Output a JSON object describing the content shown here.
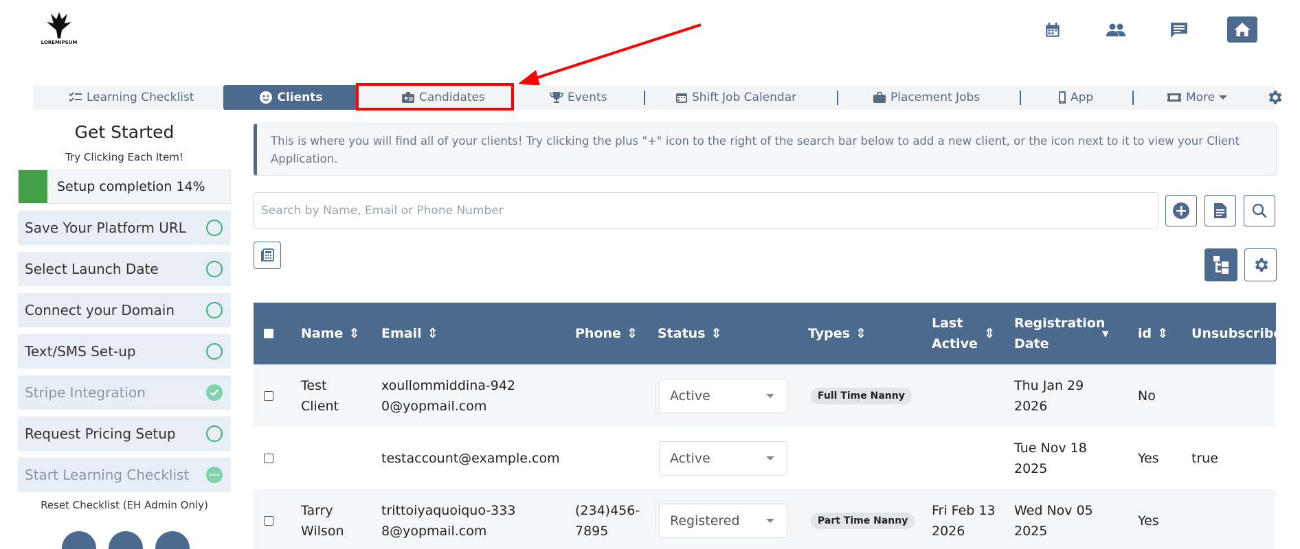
{
  "logo": {
    "text": "LOREMIPSUM"
  },
  "tabs": [
    {
      "label": "Learning Checklist"
    },
    {
      "label": "Clients"
    },
    {
      "label": "Candidates"
    },
    {
      "label": "Events"
    },
    {
      "label": "Shift Job Calendar"
    },
    {
      "label": "Placement Jobs"
    },
    {
      "label": "App"
    },
    {
      "label": "More"
    }
  ],
  "sidebar": {
    "title": "Get Started",
    "subtitle": "Try Clicking Each Item!",
    "progress": {
      "label": "Setup completion 14%",
      "percent": 14
    },
    "items": [
      {
        "label": "Save Your Platform URL",
        "status": "todo"
      },
      {
        "label": "Select Launch Date",
        "status": "todo"
      },
      {
        "label": "Connect your Domain",
        "status": "todo"
      },
      {
        "label": "Text/SMS Set-up",
        "status": "todo"
      },
      {
        "label": "Stripe Integration",
        "status": "done"
      },
      {
        "label": "Request Pricing Setup",
        "status": "todo"
      },
      {
        "label": "Start Learning Checklist",
        "status": "pending"
      }
    ],
    "reset_label": "Reset Checklist (EH Admin Only)"
  },
  "main": {
    "info_text": "This is where you will find all of your clients! Try clicking the plus \"+\" icon to the right of the search bar below to add a new client, or the icon next to it to view your Client Application.",
    "search_placeholder": "Search by Name, Email or Phone Number"
  },
  "table": {
    "columns": [
      "Name",
      "Email",
      "Phone",
      "Status",
      "Types",
      "Last Active",
      "Registration Date",
      "id",
      "Unsubscribed"
    ],
    "rows": [
      {
        "name": "Test Client",
        "email": "xoullommiddina-9420@yopmail.com",
        "phone": "",
        "status": "Active",
        "types": "Full Time Nanny",
        "last_active": "",
        "registration": "Thu Jan 29 2026",
        "id": "No",
        "unsubscribed": ""
      },
      {
        "name": "",
        "email": "testaccount@example.com",
        "phone": "",
        "status": "Active",
        "types": "",
        "last_active": "",
        "registration": "Tue Nov 18 2025",
        "id": "Yes",
        "unsubscribed": "true"
      },
      {
        "name": "Tarry Wilson",
        "email": "trittoiyaquoiquo-3338@yopmail.com",
        "phone": "(234)456-7895",
        "status": "Registered",
        "types": "Part Time Nanny",
        "last_active": "Fri Feb 13 2026",
        "registration": "Wed Nov 05 2025",
        "id": "Yes",
        "unsubscribed": ""
      }
    ]
  },
  "colors": {
    "primary": "#4b6a8e",
    "success": "#43a047",
    "annotation": "#ff0000"
  }
}
